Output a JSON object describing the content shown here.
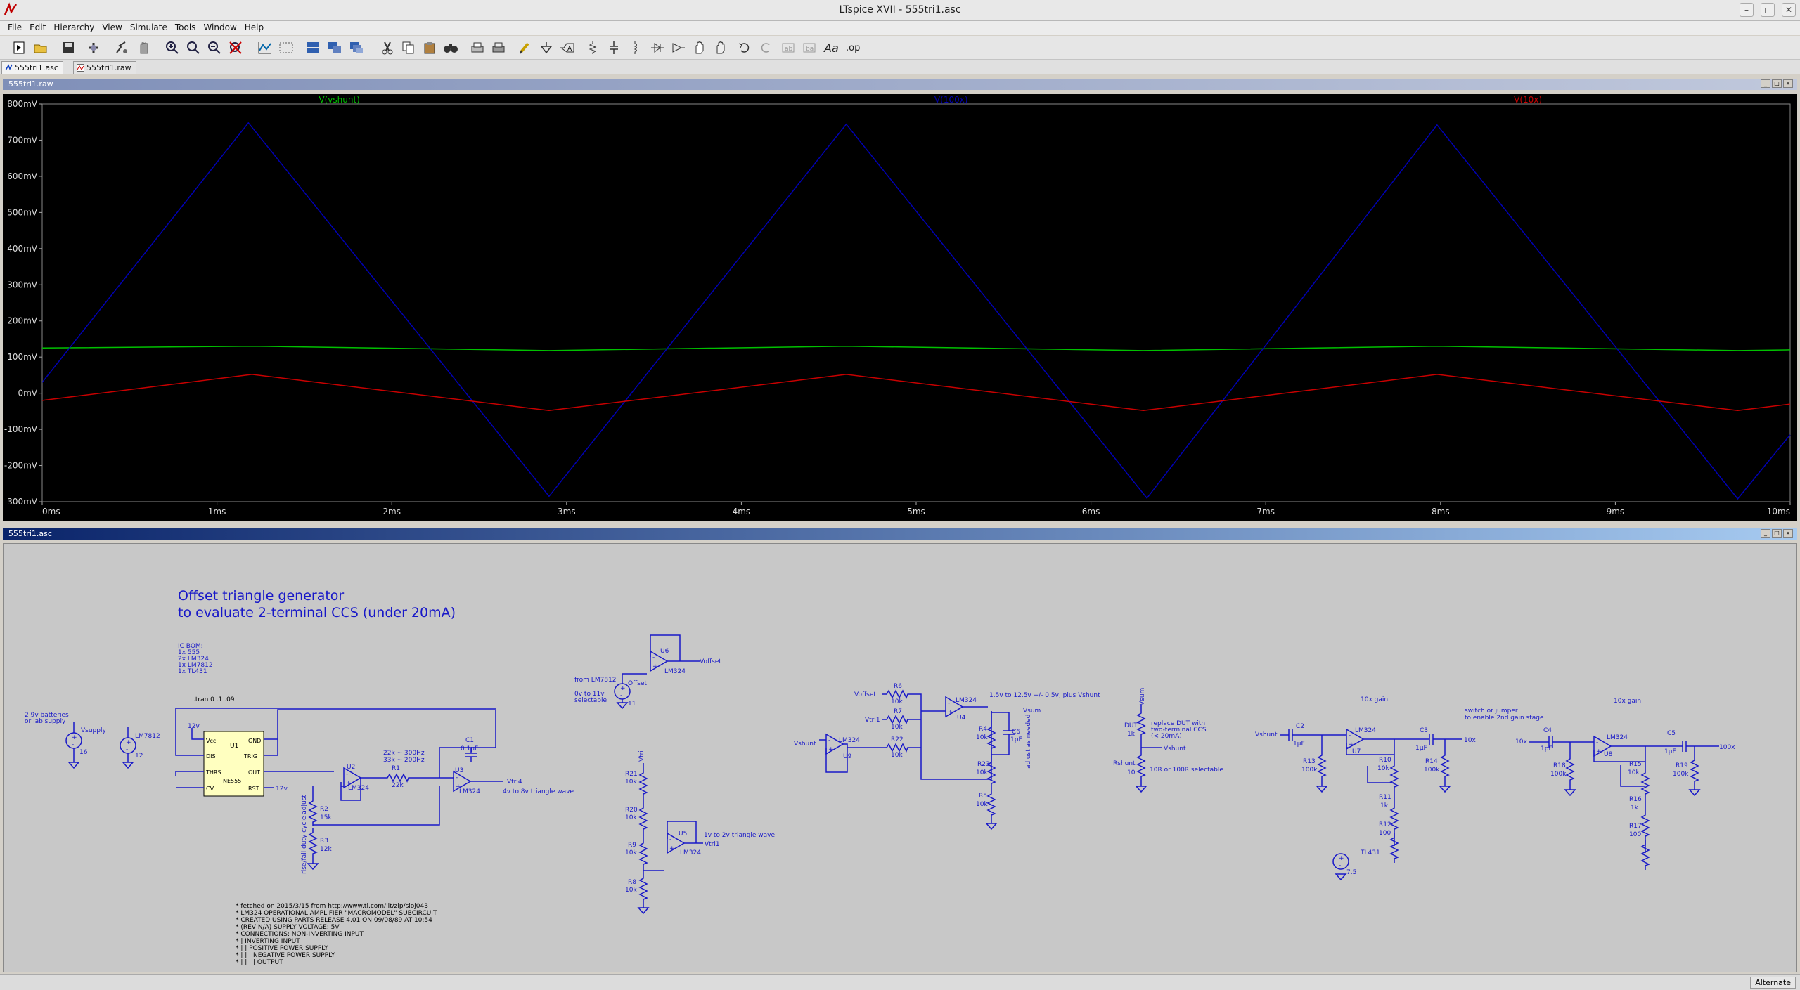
{
  "window": {
    "title": "LTspice XVII - 555tri1.asc"
  },
  "menu": [
    "File",
    "Edit",
    "Hierarchy",
    "View",
    "Simulate",
    "Tools",
    "Window",
    "Help"
  ],
  "tabs": [
    {
      "label": "555tri1.asc"
    },
    {
      "label": "555tri1.raw"
    }
  ],
  "panes": {
    "plot_title": "555tri1.raw",
    "schematic_title": "555tri1.asc"
  },
  "status": {
    "mode": "Alternate"
  },
  "chart_data": {
    "type": "line",
    "x_unit": "ms",
    "xlim": [
      0,
      10
    ],
    "ylim": [
      -300,
      800
    ],
    "y_unit": "mV",
    "x_ticks": [
      "0ms",
      "1ms",
      "2ms",
      "3ms",
      "4ms",
      "5ms",
      "6ms",
      "7ms",
      "8ms",
      "9ms",
      "10ms"
    ],
    "y_ticks": [
      "800mV",
      "700mV",
      "600mV",
      "500mV",
      "400mV",
      "300mV",
      "200mV",
      "100mV",
      "0mV",
      "-100mV",
      "-200mV",
      "-300mV"
    ],
    "grid": false,
    "legend_placement": "top",
    "series": [
      {
        "name": "V(vshunt)",
        "color": "#00c000",
        "x": [
          0,
          1.2,
          2.9,
          4.6,
          6.3,
          7.98,
          9.7,
          10
        ],
        "y": [
          125,
          130,
          118,
          130,
          118,
          130,
          118,
          120
        ]
      },
      {
        "name": "V(100x)",
        "color": "#0000b4",
        "x": [
          0,
          1.18,
          2.9,
          4.6,
          6.32,
          7.98,
          9.7,
          10
        ],
        "y": [
          30,
          748,
          -285,
          744,
          -290,
          742,
          -292,
          -115
        ]
      },
      {
        "name": "V(10x)",
        "color": "#c80000",
        "x": [
          0,
          1.2,
          2.9,
          4.6,
          6.3,
          7.98,
          9.7,
          10
        ],
        "y": [
          -20,
          52,
          -48,
          52,
          -48,
          52,
          -48,
          -30
        ]
      }
    ]
  },
  "schematic": {
    "heading_line1": "Offset triangle generator",
    "heading_line2": "to evaluate 2-terminal CCS (under 20mA)",
    "bom": [
      "IC BOM:",
      "1x 555",
      "2x LM324",
      "1x LM7812",
      "1x TL431"
    ],
    "tran": ".tran 0 .1 .09",
    "batteries": [
      "2 9v batteries",
      "or lab supply"
    ],
    "comments": [
      "* fetched on 2015/3/15 from http://www.ti.com/lit/zip/sloj043",
      "* LM324 OPERATIONAL AMPLIFIER \"MACROMODEL\" SUBCIRCUIT",
      "* CREATED USING PARTS RELEASE 4.01 ON 09/08/89 AT 10:54",
      "* (REV N/A)     SUPPLY VOLTAGE: 5V",
      "* CONNECTIONS:  NON-INVERTING INPUT",
      "*              | INVERTING INPUT",
      "*              | | POSITIVE POWER SUPPLY",
      "*              | | | NEGATIVE POWER SUPPLY",
      "*              | | | | OUTPUT"
    ],
    "notes": {
      "freq1": "22k ~ 300Hz",
      "freq2": "33k ~ 200Hz",
      "tri4": "4v to 8v triangle wave",
      "tri1": "1v to 2v triangle wave",
      "rise": "rise/fall duty cycle adjust",
      "from7812": "from LM7812",
      "sel1": "0v to 11v",
      "sel2": "selectable",
      "vsum": "1.5v to 12.5v +/- 0.5v, plus Vshunt",
      "adj": "adjust as needed",
      "dut1": "replace DUT with",
      "dut2": "two-terminal CCS",
      "dut3": "(< 20mA)",
      "rshunt": "10R or 100R selectable",
      "gain1": "10x gain",
      "gain2": "10x gain",
      "switch1": "switch or jumper",
      "switch2": "to enable 2nd gain stage"
    },
    "labels": {
      "vsupply": "Vsupply",
      "v16": "16",
      "lm7812": "LM7812",
      "v12": "12",
      "u1": "U1",
      "ne555": "NE555",
      "vcc": "Vcc",
      "gnd": "GND",
      "dis": "DIS",
      "trig": "TRIG",
      "thrs": "THRS",
      "out": "OUT",
      "cv": "CV",
      "rst": "RST",
      "r1": "R1",
      "r1v": "22k",
      "r2": "R2",
      "r2v": "15k",
      "r3": "R3",
      "r3v": "12k",
      "c1": "C1",
      "c1v": "0.1µF",
      "u2": "U2",
      "u3": "U3",
      "u4": "U4",
      "u5": "U5",
      "u6": "U6",
      "u7": "U7",
      "u8": "U8",
      "u9": "U9",
      "lm324": "LM324",
      "vtri4": "Vtri4",
      "vtri1": "Vtri1",
      "voffset": "Voffset",
      "offset": "Offset",
      "v11": "11",
      "r21": "R21",
      "r20": "R20",
      "r9": "R9",
      "r8": "R8",
      "r6": "R6",
      "r7": "R7",
      "r22": "R22",
      "r4": "R4",
      "r23": "R23",
      "r5": "R5",
      "k10": "10k",
      "vsum": "Vsum",
      "vshunt": "Vshunt",
      "dut": "DUT",
      "k1": "1k",
      "rshunt": "Rshunt",
      "ten": "10",
      "c2": "C2",
      "c3": "C3",
      "c4": "C4",
      "c5": "C5",
      "c6": "C6",
      "uf1": "1µF",
      "uf01": "1pF",
      "r13": "R13",
      "r10": "R10",
      "r11": "R11",
      "r12": "R12",
      "r14": "R14",
      "r18": "R18",
      "r15": "R15",
      "r16": "R16",
      "r17": "R17",
      "r19": "R19",
      "k100": "100k",
      "o100": "100",
      "x10": "10x",
      "x100": "100x",
      "v75": "7.5v",
      "tl431": "TL431",
      "v7_5": "7.5",
      "v12s": "12v",
      "vtri": "Vtri"
    }
  }
}
